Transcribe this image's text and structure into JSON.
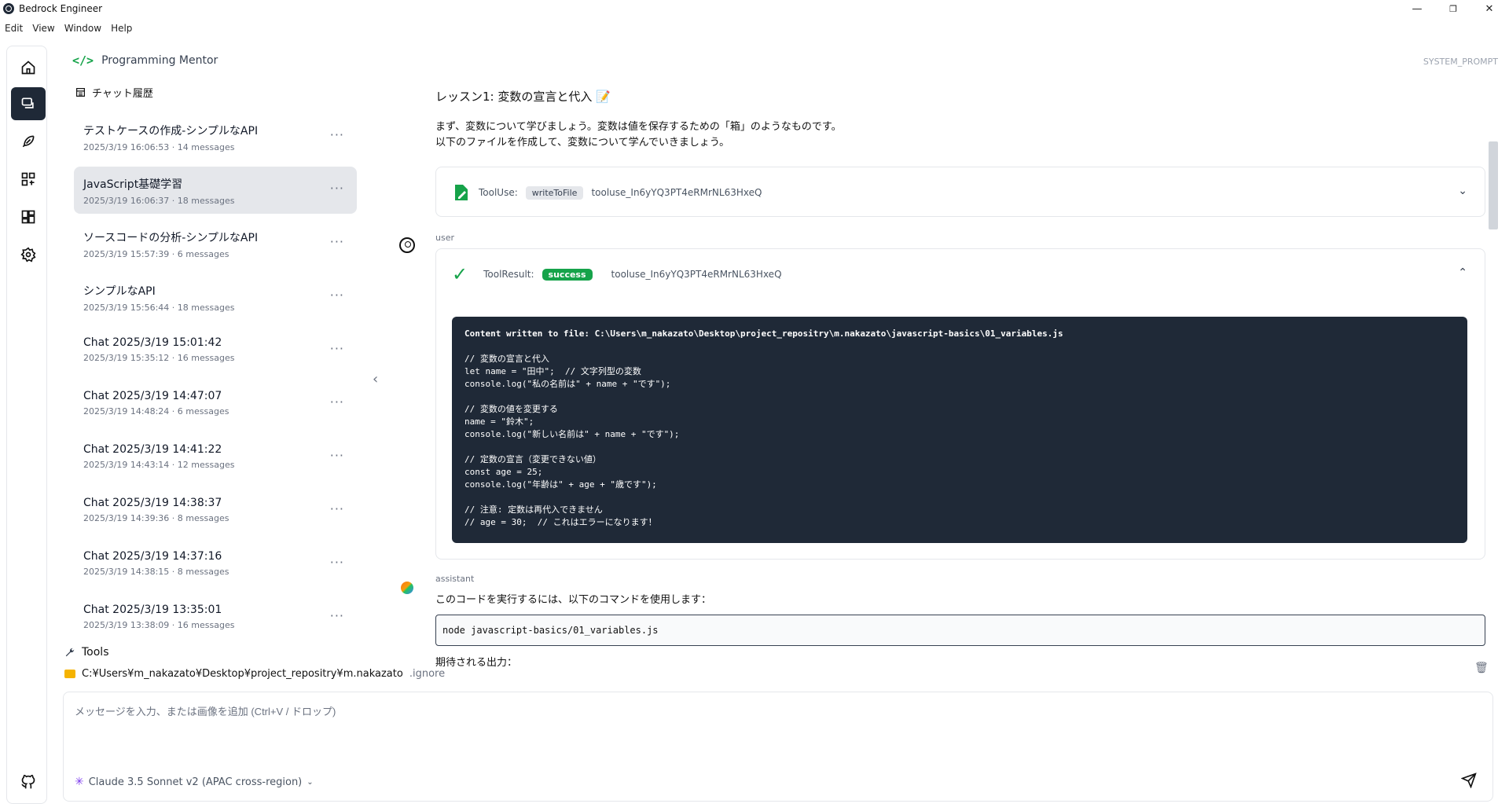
{
  "window": {
    "title": "Bedrock Engineer",
    "controls": {
      "minimize": "—",
      "restore": "❐",
      "close": "✕"
    }
  },
  "menu": [
    "Edit",
    "View",
    "Window",
    "Help"
  ],
  "agent": {
    "icon_text": "</>",
    "name": "Programming Mentor"
  },
  "history": {
    "title": "チャット履歴",
    "sessions": [
      {
        "title": "テストケースの作成-シンプルなAPI",
        "meta": "2025/3/19 16:06:53 · 14 messages"
      },
      {
        "title": "JavaScript基礎学習",
        "meta": "2025/3/19 16:06:37 · 18 messages"
      },
      {
        "title": "ソースコードの分析-シンプルなAPI",
        "meta": "2025/3/19 15:57:39 · 6 messages"
      },
      {
        "title": "シンプルなAPI",
        "meta": "2025/3/19 15:56:44 · 18 messages"
      },
      {
        "title": "Chat 2025/3/19 15:01:42",
        "meta": "2025/3/19 15:35:12 · 16 messages"
      },
      {
        "title": "Chat 2025/3/19 14:47:07",
        "meta": "2025/3/19 14:48:24 · 6 messages"
      },
      {
        "title": "Chat 2025/3/19 14:41:22",
        "meta": "2025/3/19 14:43:14 · 12 messages"
      },
      {
        "title": "Chat 2025/3/19 14:38:37",
        "meta": "2025/3/19 14:39:36 · 8 messages"
      },
      {
        "title": "Chat 2025/3/19 14:37:16",
        "meta": "2025/3/19 14:38:15 · 8 messages"
      },
      {
        "title": "Chat 2025/3/19 13:35:01",
        "meta": "2025/3/19 13:38:09 · 16 messages"
      }
    ],
    "more": "···",
    "collapse": "‹"
  },
  "tools": {
    "label": "Tools"
  },
  "directory": {
    "path": "C:¥Users¥m_nakazato¥Desktop¥project_repositry¥m.nakazato",
    "ignore": ".ignore"
  },
  "system_prompt_label": "SYSTEM_PROMPT",
  "chat": {
    "lesson_title": "レッスン1: 変数の宣言と代入 📝",
    "lesson_line1": "まず、変数について学びましょう。変数は値を保存するための「箱」のようなものです。",
    "lesson_line2": "以下のファイルを作成して、変数について学んでいきましょう。",
    "tooluse": {
      "label": "ToolUse:",
      "name": "writeToFile",
      "id": "tooluse_In6yYQ3PT4eRMrNL63HxeQ"
    },
    "user_label": "user",
    "toolresult": {
      "label": "ToolResult:",
      "status": "success",
      "id": "tooluse_In6yYQ3PT4eRMrNL63HxeQ",
      "code_first": "Content written to file: C:\\Users\\m_nakazato\\Desktop\\project_repositry\\m.nakazato\\javascript-basics\\01_variables.js",
      "code_body": "// 変数の宣言と代入\nlet name = \"田中\";  // 文字列型の変数\nconsole.log(\"私の名前は\" + name + \"です\");\n\n// 変数の値を変更する\nname = \"鈴木\";\nconsole.log(\"新しい名前は\" + name + \"です\");\n\n// 定数の宣言（変更できない値）\nconst age = 25;\nconsole.log(\"年齢は\" + age + \"歳です\");\n\n// 注意: 定数は再代入できません\n// age = 30;  // これはエラーになります！"
    },
    "assistant_label": "assistant",
    "assistant_text": "このコードを実行するには、以下のコマンドを使用します：",
    "command": "node javascript-basics/01_variables.js",
    "expected_label": "期待される出力："
  },
  "input": {
    "placeholder": "メッセージを入力、または画像を追加 (Ctrl+V / ドロップ)",
    "model": "Claude 3.5 Sonnet v2 (APAC cross-region)"
  },
  "colors": {
    "accent": "#16a34a",
    "dark": "#1f2937",
    "active_bg": "#e5e7eb"
  }
}
